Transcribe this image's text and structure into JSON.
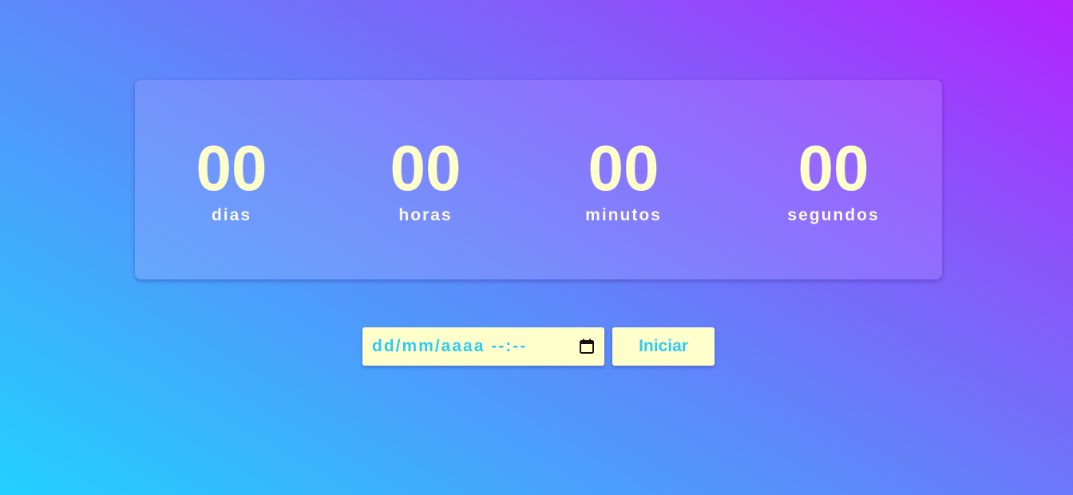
{
  "countdown": {
    "units": [
      {
        "value": "00",
        "label": "dias"
      },
      {
        "value": "00",
        "label": "horas"
      },
      {
        "value": "00",
        "label": "minutos"
      },
      {
        "value": "00",
        "label": "segundos"
      }
    ]
  },
  "controls": {
    "datetime_placeholder": "dd/mm/aaaa --:--",
    "calendar_icon": "calendar-icon",
    "start_label": "Iniciar"
  },
  "colors": {
    "digit": "#ffffcc",
    "label": "#fdf8e6",
    "accent": "#2ecbf5",
    "field_bg": "#ffffcc",
    "gradient_start": "#22d0ff",
    "gradient_end": "#b422fe"
  }
}
